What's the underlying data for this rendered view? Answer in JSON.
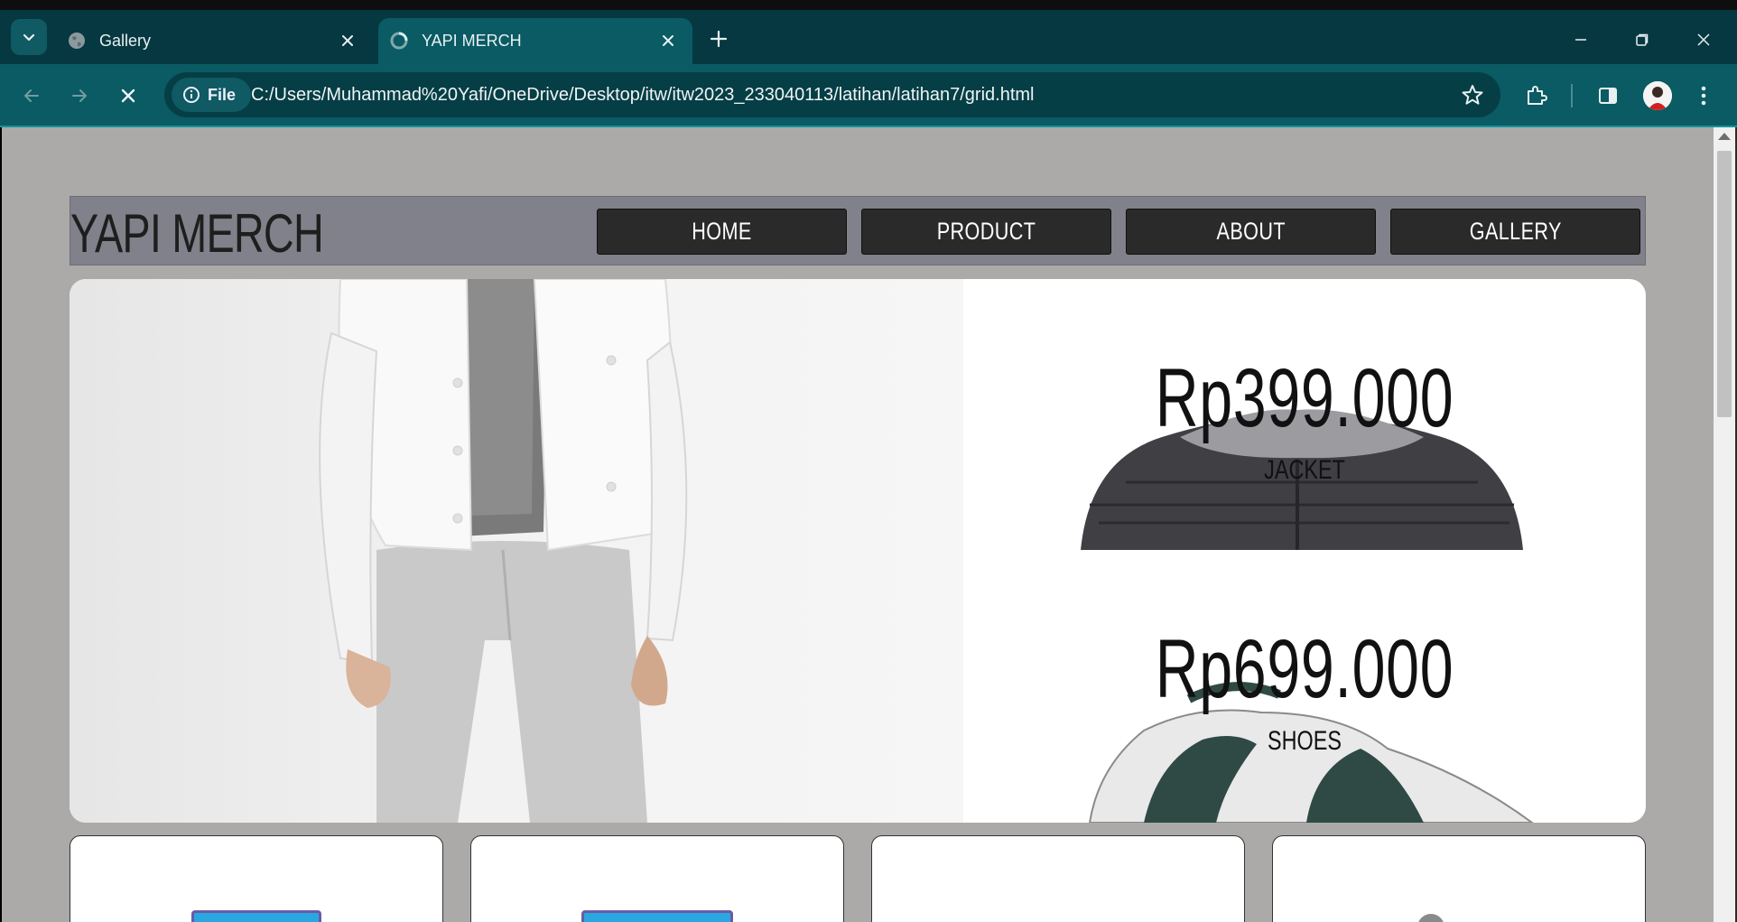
{
  "browser": {
    "tabs": [
      {
        "title": "Gallery",
        "active": false
      },
      {
        "title": "YAPI MERCH",
        "active": true
      }
    ],
    "address": {
      "chip_label": "File",
      "url": "C:/Users/Muhammad%20Yafi/OneDrive/Desktop/itw/itw2023_233040113/latihan/latihan7/grid.html"
    },
    "colors": {
      "frame": "#063841",
      "toolbar": "#0a5b63",
      "omnibox": "#063e46"
    }
  },
  "page": {
    "logo": "YAPI MERCH",
    "nav": [
      "HOME",
      "PRODUCT",
      "ABOUT",
      "GALLERY"
    ],
    "products": [
      {
        "price": "Rp399.000",
        "name": "JACKET"
      },
      {
        "price": "Rp699.000",
        "name": "SHOES"
      }
    ],
    "colors": {
      "background": "#aca9a9",
      "header": "#80818a",
      "nav_button": "#2a2a2a",
      "card_accent": "#2aa7e0"
    }
  }
}
